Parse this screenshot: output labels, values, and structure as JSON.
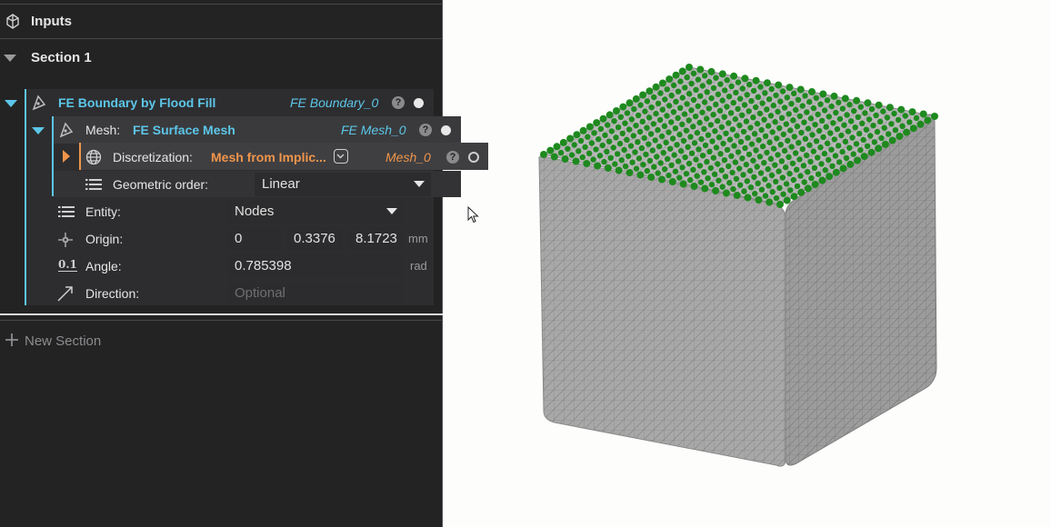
{
  "panel": {
    "header_title": "Inputs",
    "section_title": "Section 1",
    "new_section_label": "New Section"
  },
  "boundary": {
    "label": "FE Boundary by Flood Fill",
    "var": "FE Boundary_0",
    "help": "?"
  },
  "mesh": {
    "label": "Mesh:",
    "value": "FE Surface Mesh",
    "var": "FE Mesh_0",
    "help": "?"
  },
  "discretization": {
    "label": "Discretization:",
    "value": "Mesh from Implic...",
    "var": "Mesh_0",
    "help": "?"
  },
  "geometric_order": {
    "label": "Geometric order:",
    "value": "Linear"
  },
  "entity": {
    "label": "Entity:",
    "value": "Nodes"
  },
  "origin": {
    "label": "Origin:",
    "x": "0",
    "y": "0.3376",
    "z": "8.1723",
    "unit": "mm"
  },
  "angle": {
    "label": "Angle:",
    "value": "0.785398",
    "unit": "rad",
    "icon_text": "0.1"
  },
  "direction": {
    "label": "Direction:",
    "placeholder": "Optional"
  },
  "colors": {
    "accent_cyan": "#5cc6e8",
    "accent_orange": "#f0954a",
    "node_green": "#1e8a1e",
    "mesh_grey": "#a9a9a9"
  }
}
